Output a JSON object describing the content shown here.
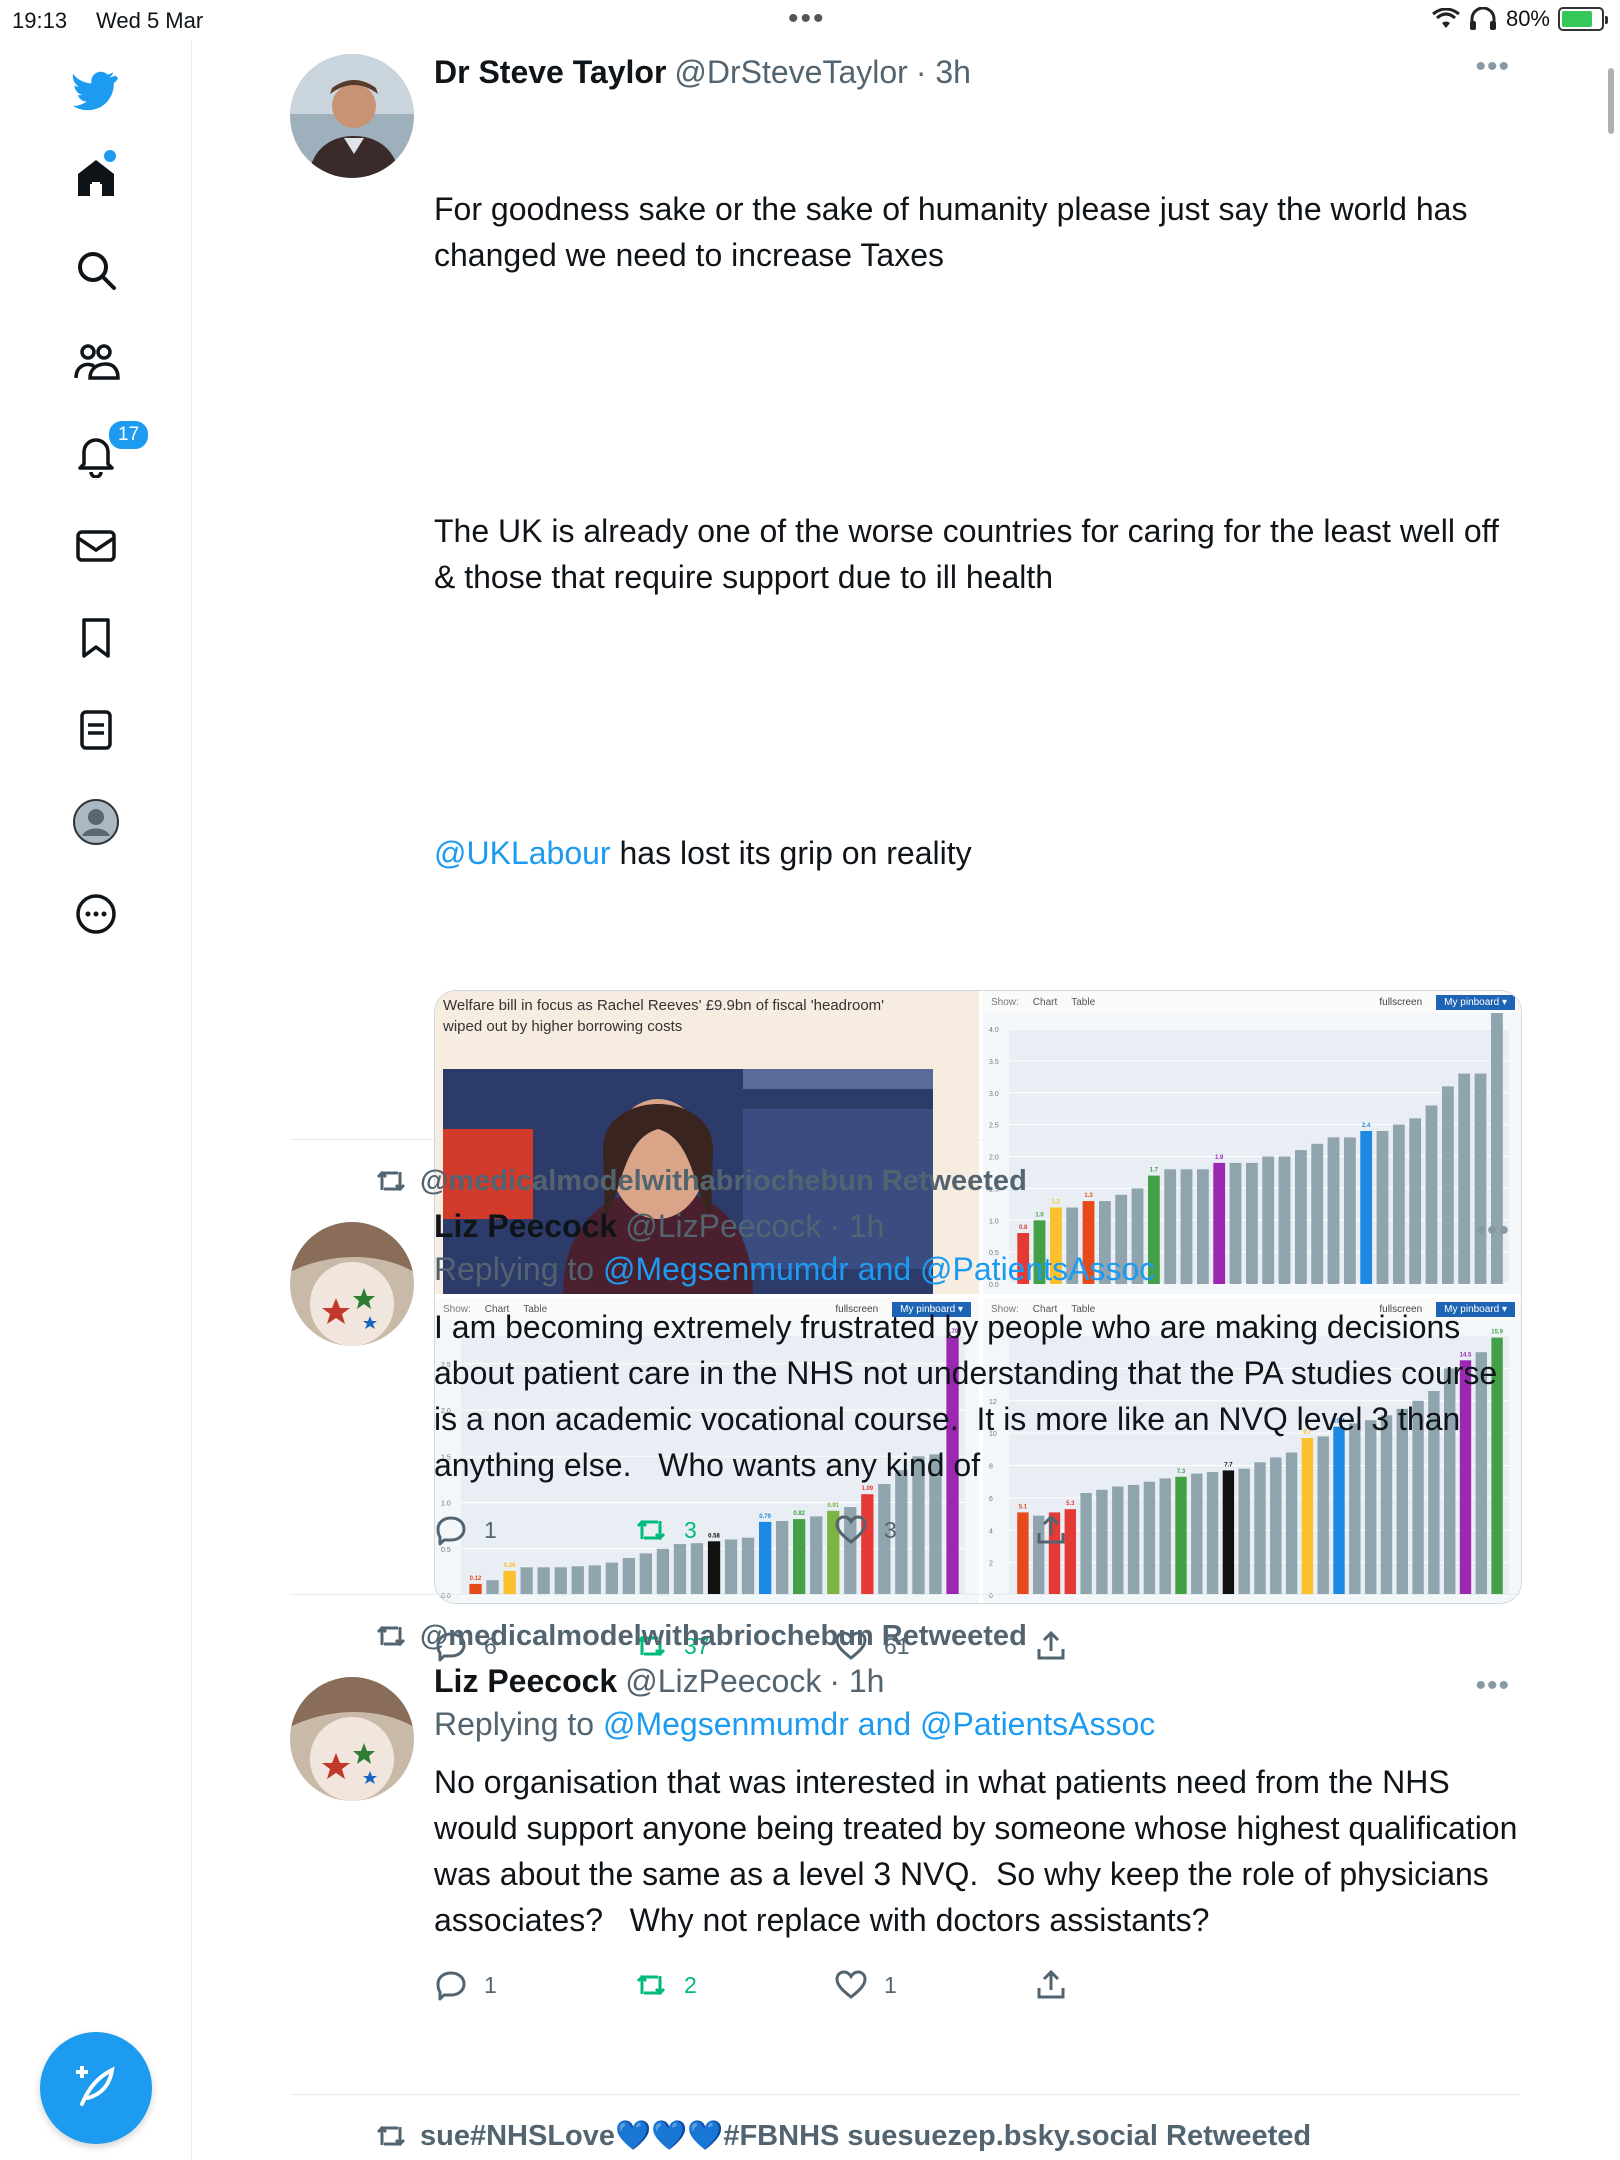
{
  "status_bar": {
    "time": "19:13",
    "date": "Wed 5 Mar",
    "battery": "80%"
  },
  "sidebar": {
    "notifications_badge": "17"
  },
  "tweets": [
    {
      "name": "Dr Steve Taylor",
      "handle": "@DrSteveTaylor",
      "time": "· 3h",
      "text_1": "For goodness sake or the sake of humanity please just say the world has changed we need to increase Taxes",
      "text_2": "The UK is already one of the worse countries for caring for the least well off & those that require support due to ill health",
      "mention": "@UKLabour",
      "text_3": " has lost its grip on reality",
      "media": {
        "article_headline": "Welfare bill in focus as Rachel Reeves' £9.9bn of fiscal 'headroom' wiped out by higher borrowing costs",
        "chart_toolbar": {
          "show": "Show:",
          "chart_tab": "Chart",
          "table_tab": "Table",
          "fullscreen": "fullscreen",
          "pinboard": "My pinboard ▾"
        }
      },
      "replies": "6",
      "retweets": "37",
      "likes": "61"
    },
    {
      "retweeted_by": "@medicalmodelwithabriochebun Retweeted",
      "name": "Liz Peecock",
      "handle": "@LizPeecock",
      "time": "· 1h",
      "replying_prefix": "Replying to ",
      "replying_to": "@Megsenmumdr and @PatientsAssoc",
      "text": "I am becoming extremely frustrated by people who are making decisions about patient care in the NHS not understanding that the PA studies course is a non academic vocational course.  It is more like an NVQ level 3 than anything else.   Who wants any kind of",
      "replies": "1",
      "retweets": "3",
      "likes": "3"
    },
    {
      "retweeted_by": "@medicalmodelwithabriochebun Retweeted",
      "name": "Liz Peecock",
      "handle": "@LizPeecock",
      "time": "· 1h",
      "replying_prefix": "Replying to ",
      "replying_to": "@Megsenmumdr and @PatientsAssoc",
      "text": "No organisation that was interested in what patients need from the NHS would support anyone being treated by someone whose highest qualification was about the same as a level 3 NVQ.  So why keep the role of physicians associates?   Why not replace with doctors assistants?",
      "replies": "1",
      "retweets": "2",
      "likes": "1"
    },
    {
      "retweeted_by": "sue#NHSLove💙💙💙#FBNHS suesuezep.bsky.social Retweeted"
    }
  ],
  "chart_data": [
    {
      "type": "bar",
      "ylim": [
        0,
        4.0
      ],
      "yticks": [
        "0.0",
        "0.5",
        "1.0",
        "1.5",
        "2.0",
        "2.5",
        "3.0",
        "3.5",
        "4.0"
      ],
      "values": [
        0.8,
        1.0,
        1.2,
        1.2,
        1.3,
        1.3,
        1.4,
        1.5,
        1.7,
        1.8,
        1.8,
        1.8,
        1.9,
        1.9,
        1.9,
        2.0,
        2.0,
        2.1,
        2.2,
        2.3,
        2.3,
        2.4,
        2.4,
        2.5,
        2.6,
        2.8,
        3.1,
        3.3,
        3.3,
        4.4
      ],
      "colors": [
        "#e53935",
        "#43a047",
        "#fbc02d",
        "#90a4ae",
        "#e64a19",
        "#90a4ae",
        "#90a4ae",
        "#90a4ae",
        "#43a047",
        "#90a4ae",
        "#90a4ae",
        "#90a4ae",
        "#9c27b0",
        "#90a4ae",
        "#90a4ae",
        "#90a4ae",
        "#90a4ae",
        "#90a4ae",
        "#90a4ae",
        "#90a4ae",
        "#90a4ae",
        "#1e88e5",
        "#90a4ae",
        "#90a4ae",
        "#90a4ae",
        "#90a4ae",
        "#90a4ae",
        "#90a4ae",
        "#90a4ae",
        "#90a4ae"
      ],
      "labels": {
        "0": "0.8",
        "1": "1.0",
        "2": "1.2",
        "4": "1.3",
        "8": "1.7",
        "12": "1.9",
        "21": "2.4"
      }
    },
    {
      "type": "bar",
      "ylim": [
        0,
        2.8
      ],
      "yticks": [
        "0.0",
        "0.5",
        "1.0",
        "1.5",
        "2.0",
        "2.5"
      ],
      "values": [
        0.12,
        0.16,
        0.26,
        0.3,
        0.3,
        0.3,
        0.31,
        0.32,
        0.35,
        0.4,
        0.45,
        0.5,
        0.55,
        0.56,
        0.58,
        0.6,
        0.62,
        0.79,
        0.8,
        0.82,
        0.85,
        0.91,
        0.95,
        1.09,
        1.2,
        1.35,
        1.5,
        1.52,
        2.79
      ],
      "colors": [
        "#e64a19",
        "#90a4ae",
        "#fbc02d",
        "#90a4ae",
        "#90a4ae",
        "#90a4ae",
        "#90a4ae",
        "#90a4ae",
        "#90a4ae",
        "#90a4ae",
        "#90a4ae",
        "#90a4ae",
        "#90a4ae",
        "#90a4ae",
        "#111111",
        "#90a4ae",
        "#90a4ae",
        "#1e88e5",
        "#90a4ae",
        "#43a047",
        "#90a4ae",
        "#7cb342",
        "#90a4ae",
        "#e53935",
        "#90a4ae",
        "#90a4ae",
        "#90a4ae",
        "#90a4ae",
        "#9c27b0"
      ],
      "labels": {
        "0": "0.12",
        "2": "0.26",
        "14": "0.58",
        "17": "0.79",
        "19": "0.82",
        "21": "0.91",
        "23": "1.09",
        "28": "2.79"
      }
    },
    {
      "type": "bar",
      "ylim": [
        0,
        16
      ],
      "yticks": [
        "0",
        "2",
        "4",
        "6",
        "8",
        "10",
        "12",
        "14"
      ],
      "values": [
        5.1,
        4.9,
        5.1,
        5.3,
        6.3,
        6.5,
        6.7,
        6.8,
        7.0,
        7.2,
        7.3,
        7.5,
        7.6,
        7.7,
        7.8,
        8.2,
        8.5,
        8.8,
        9.7,
        9.8,
        10.4,
        10.6,
        10.8,
        11.1,
        11.5,
        12.0,
        12.6,
        14.0,
        14.5,
        15.0,
        15.9
      ],
      "colors": [
        "#e64a19",
        "#90a4ae",
        "#e53935",
        "#e53935",
        "#90a4ae",
        "#90a4ae",
        "#90a4ae",
        "#90a4ae",
        "#90a4ae",
        "#90a4ae",
        "#43a047",
        "#90a4ae",
        "#90a4ae",
        "#111111",
        "#90a4ae",
        "#90a4ae",
        "#90a4ae",
        "#90a4ae",
        "#fbc02d",
        "#90a4ae",
        "#1e88e5",
        "#90a4ae",
        "#90a4ae",
        "#90a4ae",
        "#90a4ae",
        "#90a4ae",
        "#90a4ae",
        "#90a4ae",
        "#9c27b0",
        "#90a4ae",
        "#43a047"
      ],
      "labels": {
        "0": "5.1",
        "3": "5.3",
        "10": "7.3",
        "13": "7.7",
        "18": "9.7",
        "20": "10.4",
        "28": "14.5",
        "30": "15.9"
      }
    }
  ]
}
